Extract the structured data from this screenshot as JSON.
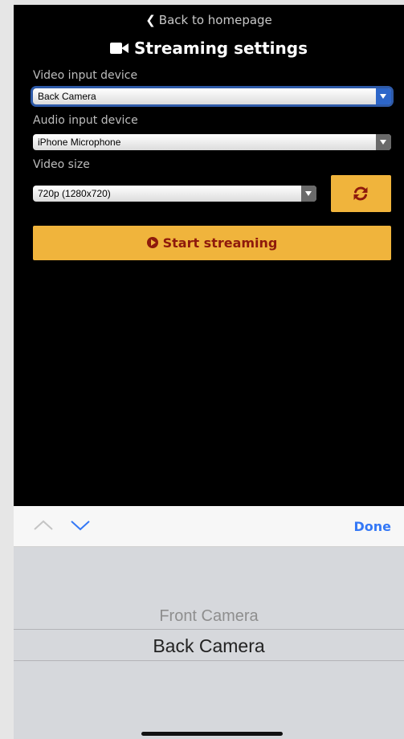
{
  "header": {
    "back_label": "Back to homepage",
    "title": "Streaming settings"
  },
  "form": {
    "video_input": {
      "label": "Video input device",
      "value": "Back Camera"
    },
    "audio_input": {
      "label": "Audio input device",
      "value": "iPhone Microphone"
    },
    "video_size": {
      "label": "Video size",
      "value": "720p (1280x720)"
    }
  },
  "actions": {
    "start_label": "Start streaming",
    "refresh_icon": "refresh-icon"
  },
  "keyboard_toolbar": {
    "done_label": "Done"
  },
  "picker": {
    "options": [
      "Front Camera",
      "Back Camera"
    ],
    "selected": "Back Camera"
  },
  "colors": {
    "accent": "#f0b43c",
    "accent_text": "#8e1a0c",
    "ios_blue": "#3478f6",
    "focus": "#2e5aa8"
  }
}
